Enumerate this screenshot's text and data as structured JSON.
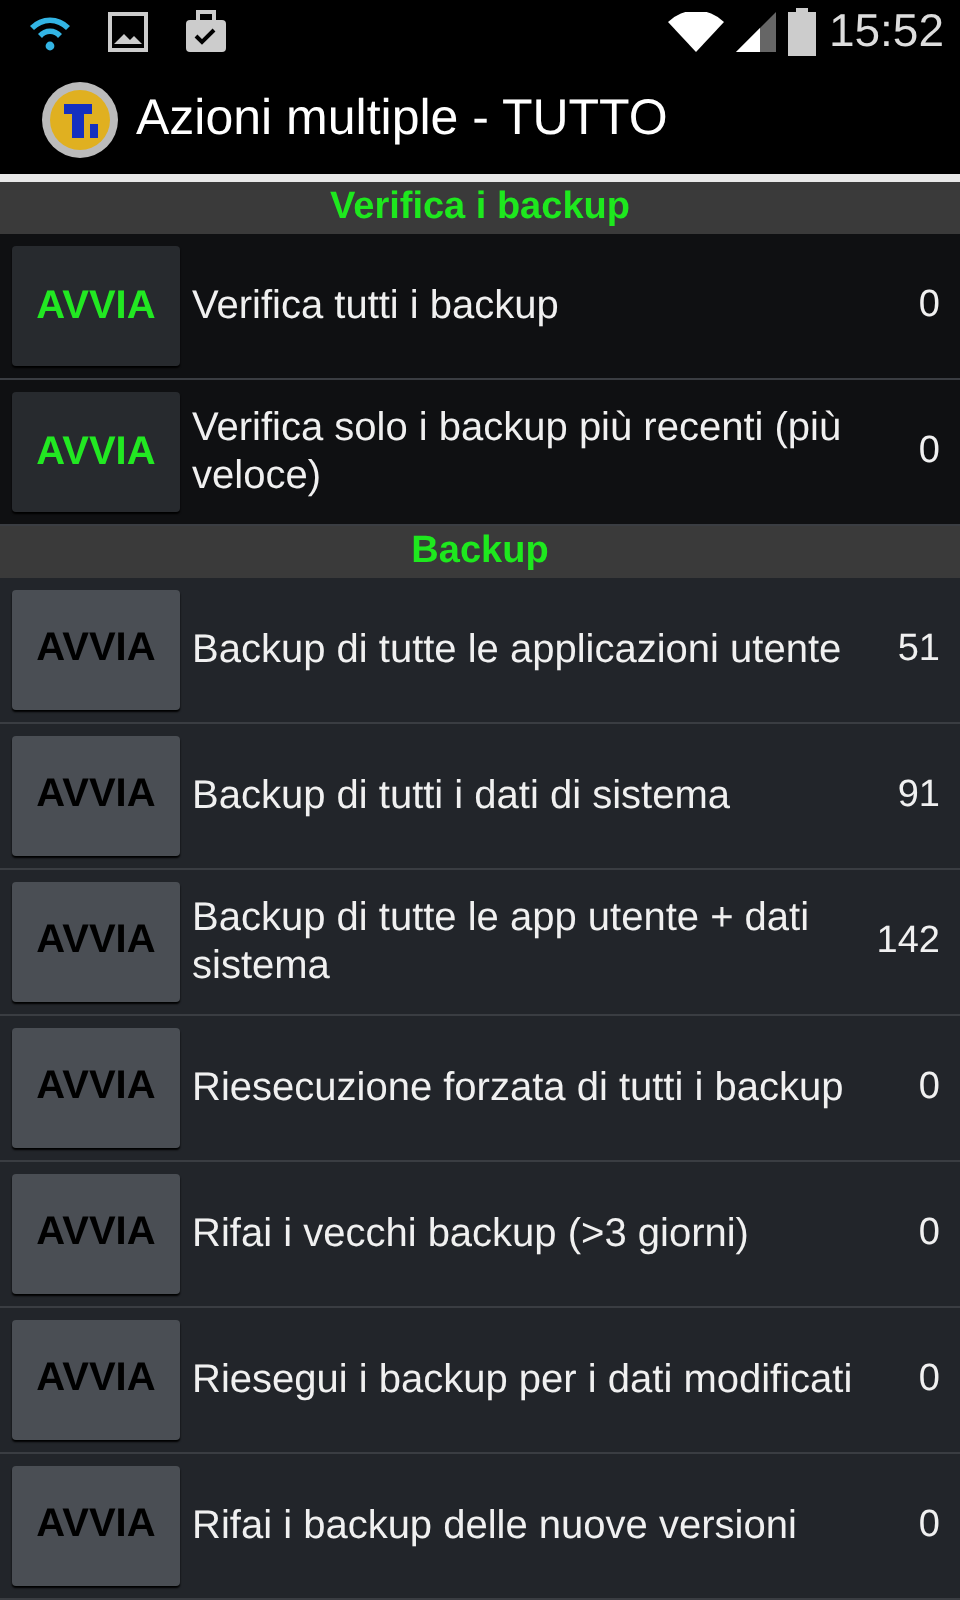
{
  "status_bar": {
    "time": "15:52"
  },
  "action_bar": {
    "title": "Azioni multiple - TUTTO"
  },
  "sections": [
    {
      "title": "Verifica i backup",
      "rows": [
        {
          "button": "AVVIA",
          "enabled": true,
          "label": "Verifica tutti i backup",
          "count": "0"
        },
        {
          "button": "AVVIA",
          "enabled": true,
          "label": "Verifica solo i backup più recenti (più veloce)",
          "count": "0"
        }
      ]
    },
    {
      "title": "Backup",
      "rows": [
        {
          "button": "AVVIA",
          "enabled": false,
          "label": "Backup di tutte le applicazioni utente",
          "count": "51"
        },
        {
          "button": "AVVIA",
          "enabled": false,
          "label": "Backup di tutti i dati di sistema",
          "count": "91"
        },
        {
          "button": "AVVIA",
          "enabled": false,
          "label": "Backup di tutte le app utente + dati sistema",
          "count": "142"
        },
        {
          "button": "AVVIA",
          "enabled": false,
          "label": "Riesecuzione forzata di tutti i backup",
          "count": "0"
        },
        {
          "button": "AVVIA",
          "enabled": false,
          "label": "Rifai i vecchi backup (>3 giorni)",
          "count": "0"
        },
        {
          "button": "AVVIA",
          "enabled": false,
          "label": "Riesegui i backup per i dati modificati",
          "count": "0"
        },
        {
          "button": "AVVIA",
          "enabled": false,
          "label": "Rifai i backup delle nuove versioni",
          "count": "0"
        }
      ]
    }
  ]
}
